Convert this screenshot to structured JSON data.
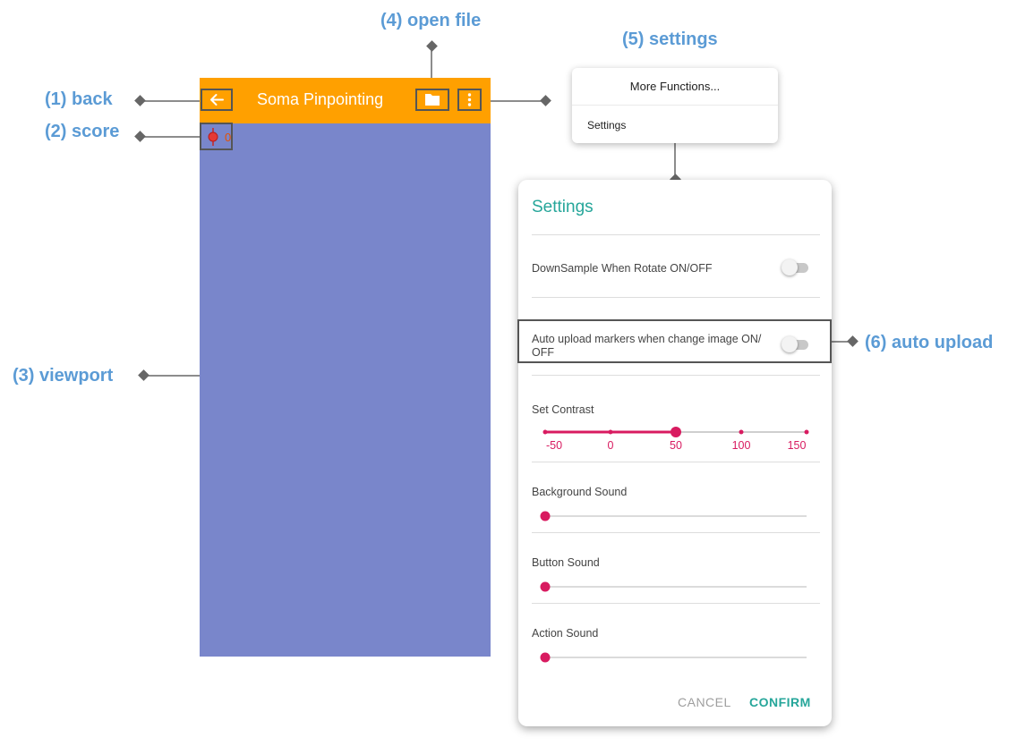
{
  "callouts": {
    "back": "(1) back",
    "score": "(2) score",
    "viewport": "(3) viewport",
    "open_file": "(4) open file",
    "settings": "(5) settings",
    "auto_upload": "(6) auto upload"
  },
  "app": {
    "title": "Soma Pinpointing",
    "score_value": "0",
    "toolbar_color": "#ffa000",
    "viewport_color": "#7986cb"
  },
  "icons": {
    "back": "arrow-left-icon",
    "open_file": "folder-icon",
    "more": "more-vert-icon",
    "score": "marker-icon"
  },
  "menu": {
    "header": "More Functions...",
    "item": "Settings"
  },
  "settings": {
    "title": "Settings",
    "downsample_label": "DownSample When Rotate ON/OFF",
    "downsample_on": false,
    "auto_upload_label_line1": "Auto upload markers when change image ON/",
    "auto_upload_label_line2": "OFF",
    "auto_upload_on": false,
    "contrast_label": "Set Contrast",
    "contrast_ticks": [
      "-50",
      "0",
      "50",
      "100",
      "150"
    ],
    "contrast_value": "50",
    "background_sound_label": "Background Sound",
    "background_sound_value": 0,
    "button_sound_label": "Button Sound",
    "button_sound_value": 0,
    "action_sound_label": "Action Sound",
    "action_sound_value": 0,
    "cancel": "CANCEL",
    "confirm": "CONFIRM"
  }
}
